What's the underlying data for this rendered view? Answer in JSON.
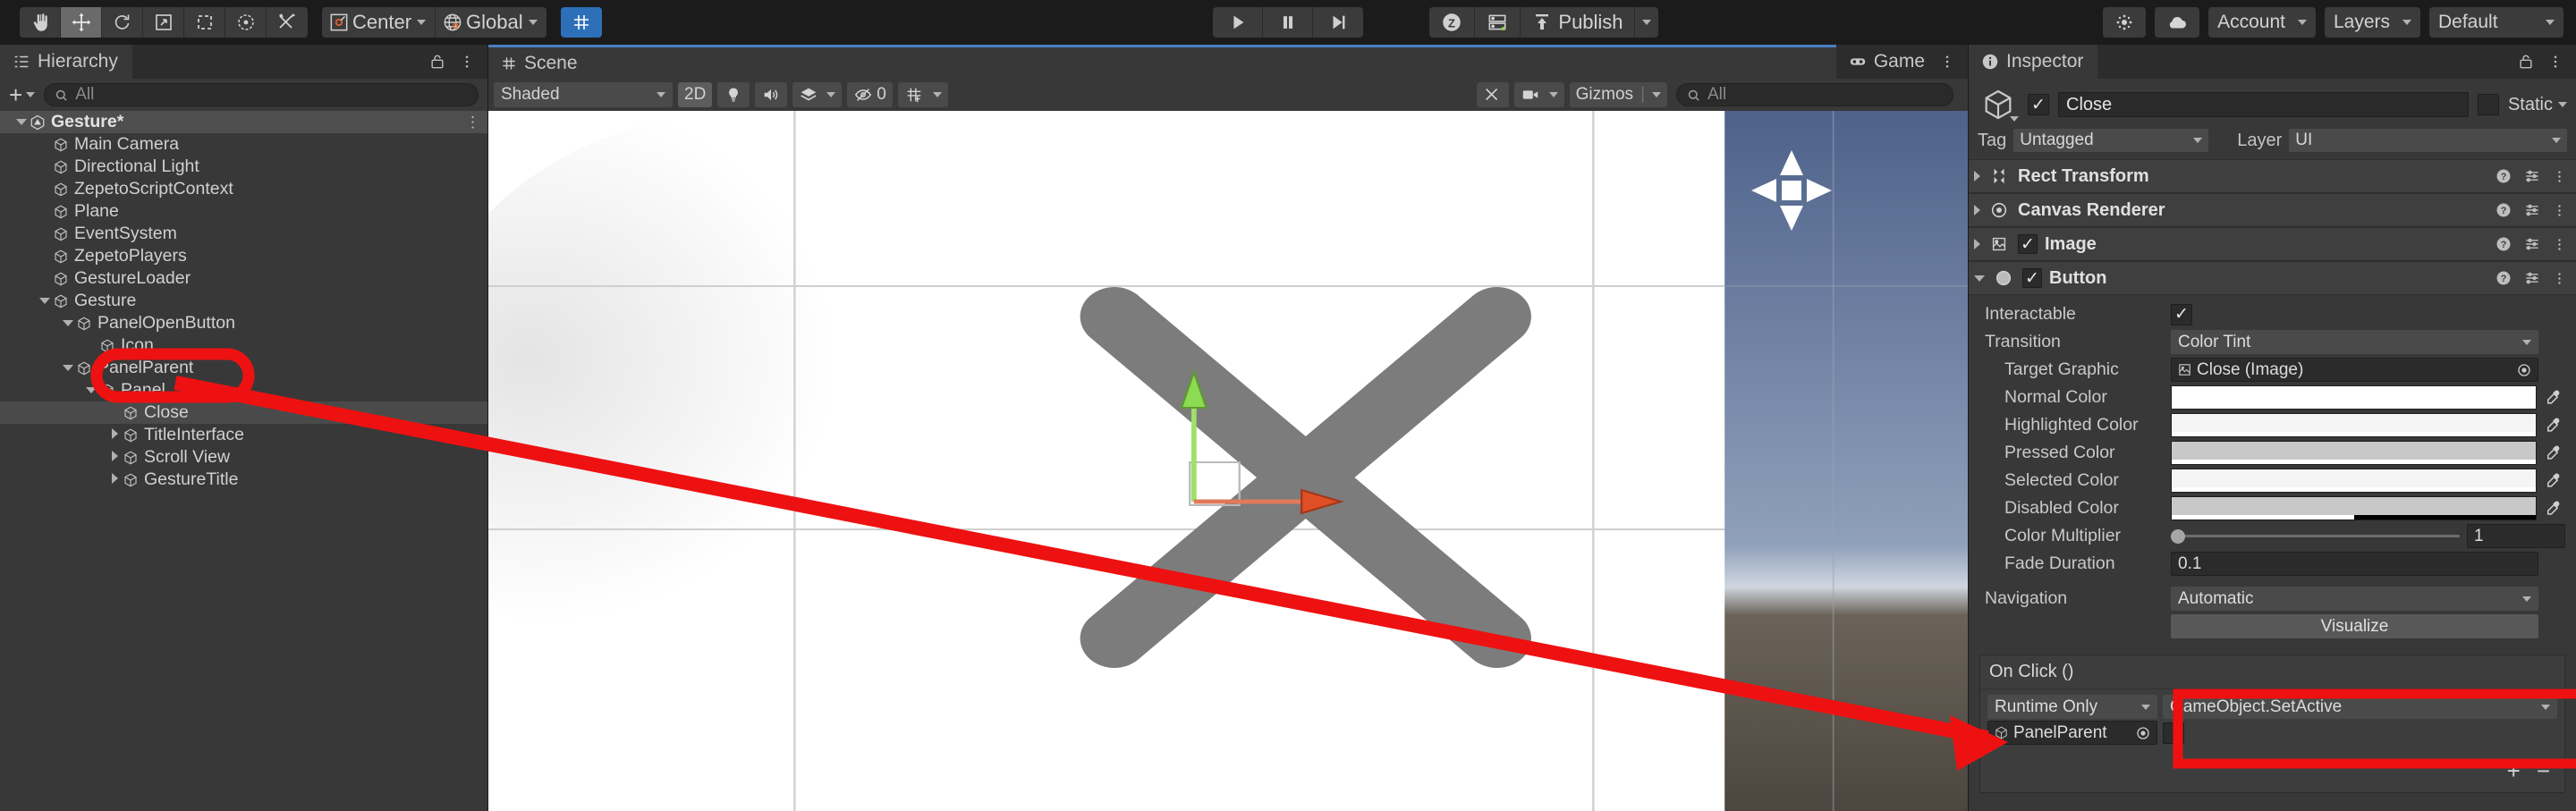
{
  "toolbar": {
    "tools": [
      {
        "name": "hand-tool",
        "icon": "hand",
        "active": false
      },
      {
        "name": "move-tool",
        "icon": "move",
        "active": true
      },
      {
        "name": "rotate-tool",
        "icon": "rotate",
        "active": false
      },
      {
        "name": "scale-tool",
        "icon": "scale",
        "active": false
      },
      {
        "name": "rect-tool",
        "icon": "rect",
        "active": false
      },
      {
        "name": "transform-tool",
        "icon": "transform",
        "active": false
      },
      {
        "name": "custom-tool",
        "icon": "wrench",
        "active": false
      }
    ],
    "pivot_mode": "Center",
    "pivot_rotation": "Global",
    "grid_snap_label": "",
    "play": "play",
    "pause": "pause",
    "step": "step",
    "zepeto_label": "",
    "layout_label": "",
    "publish_label": "Publish",
    "account_label": "Account",
    "layers_label": "Layers",
    "layout_preset_label": "Default"
  },
  "hierarchy": {
    "tab_label": "Hierarchy",
    "search": {
      "value": "",
      "placeholder": "All"
    },
    "create_label": "+",
    "items": [
      {
        "label": "Gesture*",
        "depth": 0,
        "twisty": "down",
        "root": true,
        "selected": false,
        "kebab": true
      },
      {
        "label": "Main Camera",
        "depth": 1,
        "twisty": "none",
        "selected": false
      },
      {
        "label": "Directional Light",
        "depth": 1,
        "twisty": "none",
        "selected": false
      },
      {
        "label": "ZepetoScriptContext",
        "depth": 1,
        "twisty": "none",
        "selected": false
      },
      {
        "label": "Plane",
        "depth": 1,
        "twisty": "none",
        "selected": false
      },
      {
        "label": "EventSystem",
        "depth": 1,
        "twisty": "none",
        "selected": false
      },
      {
        "label": "ZepetoPlayers",
        "depth": 1,
        "twisty": "none",
        "selected": false
      },
      {
        "label": "GestureLoader",
        "depth": 1,
        "twisty": "none",
        "selected": false
      },
      {
        "label": "Gesture",
        "depth": 1,
        "twisty": "down",
        "selected": false
      },
      {
        "label": "PanelOpenButton",
        "depth": 2,
        "twisty": "down",
        "selected": false
      },
      {
        "label": "Icon",
        "depth": 3,
        "twisty": "none",
        "selected": false
      },
      {
        "label": "PanelParent",
        "depth": 2,
        "twisty": "down",
        "selected": false
      },
      {
        "label": "Panel",
        "depth": 3,
        "twisty": "down",
        "selected": false
      },
      {
        "label": "Close",
        "depth": 4,
        "twisty": "none",
        "selected": true
      },
      {
        "label": "TitleInterface",
        "depth": 4,
        "twisty": "right",
        "selected": false
      },
      {
        "label": "Scroll View",
        "depth": 4,
        "twisty": "right",
        "selected": false
      },
      {
        "label": "GestureTitle",
        "depth": 4,
        "twisty": "right",
        "selected": false
      }
    ]
  },
  "scene": {
    "tabs": [
      {
        "label": "Scene",
        "icon": "grid-icon",
        "selected": true
      },
      {
        "label": "Game",
        "icon": "gamepad-icon",
        "selected": false
      }
    ],
    "shading_mode": "Shaded",
    "mode_2d": "2D",
    "lighting_icon": "light-bulb-icon",
    "audio_icon": "speaker-icon",
    "fx_icon": "effects-icon",
    "hidden_count": "0",
    "grid_icon": "grid-visibility-icon",
    "gizmos_label": "Gizmos",
    "search": {
      "value": "",
      "placeholder": "All"
    }
  },
  "inspector": {
    "tab_label": "Inspector",
    "object_name": "Close",
    "object_enabled": true,
    "static_label": "Static",
    "static_checked": false,
    "tag_label": "Tag",
    "tag_value": "Untagged",
    "layer_label": "Layer",
    "layer_value": "UI",
    "components": [
      {
        "name": "Rect Transform",
        "expanded": false,
        "has_toggle": false,
        "icon": "rect-transform-icon"
      },
      {
        "name": "Canvas Renderer",
        "expanded": false,
        "has_toggle": false,
        "icon": "canvas-renderer-icon"
      },
      {
        "name": "Image",
        "expanded": false,
        "has_toggle": true,
        "enabled": true,
        "icon": "image-component-icon"
      },
      {
        "name": "Button",
        "expanded": true,
        "has_toggle": true,
        "enabled": true,
        "icon": "button-component-icon"
      }
    ],
    "button": {
      "interactable_label": "Interactable",
      "interactable_value": true,
      "transition_label": "Transition",
      "transition_value": "Color Tint",
      "target_graphic_label": "Target Graphic",
      "target_graphic_value": "Close (Image)",
      "colors": [
        {
          "label": "Normal Color",
          "hex": "#ffffff",
          "alpha": 100
        },
        {
          "label": "Highlighted Color",
          "hex": "#f5f5f5",
          "alpha": 100
        },
        {
          "label": "Pressed Color",
          "hex": "#c8c8c8",
          "alpha": 100
        },
        {
          "label": "Selected Color",
          "hex": "#f5f5f5",
          "alpha": 100
        },
        {
          "label": "Disabled Color",
          "hex": "#c8c8c8",
          "alpha": 50
        }
      ],
      "color_multiplier_label": "Color Multiplier",
      "color_multiplier_value": "1",
      "fade_duration_label": "Fade Duration",
      "fade_duration_value": "0.1",
      "navigation_label": "Navigation",
      "navigation_value": "Automatic",
      "visualize_label": "Visualize"
    },
    "on_click": {
      "title": "On Click ()",
      "entries": [
        {
          "call_state": "Runtime Only",
          "function": "GameObject.SetActive",
          "object": "PanelParent",
          "arg_checked": false
        }
      ],
      "add_label": "+",
      "remove_label": "−"
    }
  },
  "annotations": {
    "accent_color": "#ee1111",
    "ellipse_target": "PanelParent hierarchy row",
    "box_target": "GameObject.SetActive function dropdown",
    "arrow": "from PanelParent in hierarchy to On Click function field"
  }
}
